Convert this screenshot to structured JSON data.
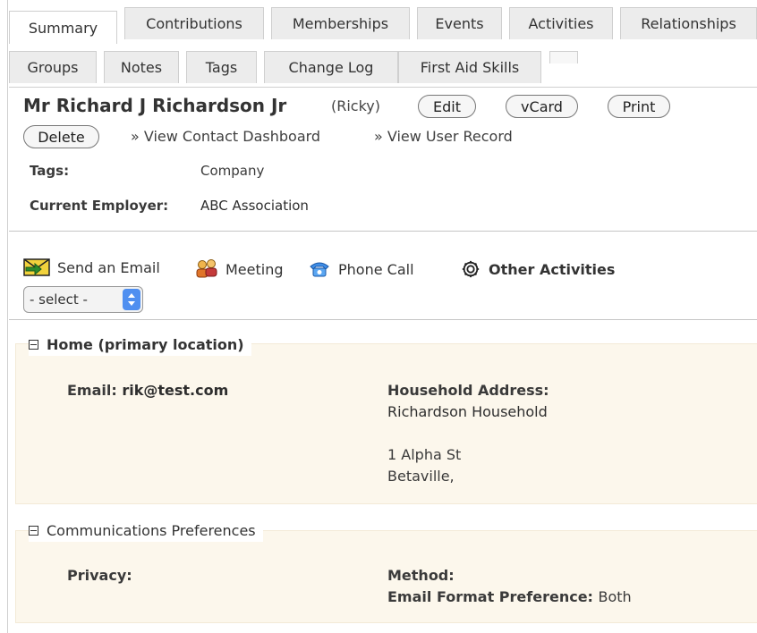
{
  "tabs": {
    "row1": [
      "Summary",
      "Contributions",
      "Memberships",
      "Events",
      "Activities",
      "Relationships"
    ],
    "row2": [
      "Groups",
      "Notes",
      "Tags",
      "Change Log",
      "First Aid Skills"
    ]
  },
  "contact": {
    "name": "Mr Richard J Richardson Jr",
    "nickname": "(Ricky)",
    "buttons": {
      "edit": "Edit",
      "vcard": "vCard",
      "print": "Print",
      "delete": "Delete"
    },
    "links": {
      "dashboard": "» View Contact Dashboard",
      "user_record": "» View User Record"
    }
  },
  "fields": {
    "tags_label": "Tags:",
    "tags_value": "Company",
    "employer_label": "Current Employer:",
    "employer_value": "ABC Association"
  },
  "activities": {
    "email": "Send an Email",
    "meeting": "Meeting",
    "phone": "Phone Call",
    "other": "Other Activities",
    "select_value": "- select -"
  },
  "home": {
    "title": "Home (primary location)",
    "email_label": "Email:",
    "email_value": "rik@test.com",
    "address_label": "Household Address:",
    "address_lines": [
      "Richardson Household",
      "1 Alpha St",
      "Betaville,"
    ]
  },
  "comm": {
    "title": "Communications Preferences",
    "privacy_label": "Privacy:",
    "method_label": "Method:",
    "format_label": "Email Format Preference:",
    "format_value": "Both"
  },
  "icons": {
    "email": "envelope-arrow-icon",
    "meeting": "people-icon",
    "phone": "telephone-icon",
    "other": "gear-icon"
  },
  "colors": {
    "panel_bg": "#fcf7ec",
    "select_arrow": "#4f8ff0"
  }
}
